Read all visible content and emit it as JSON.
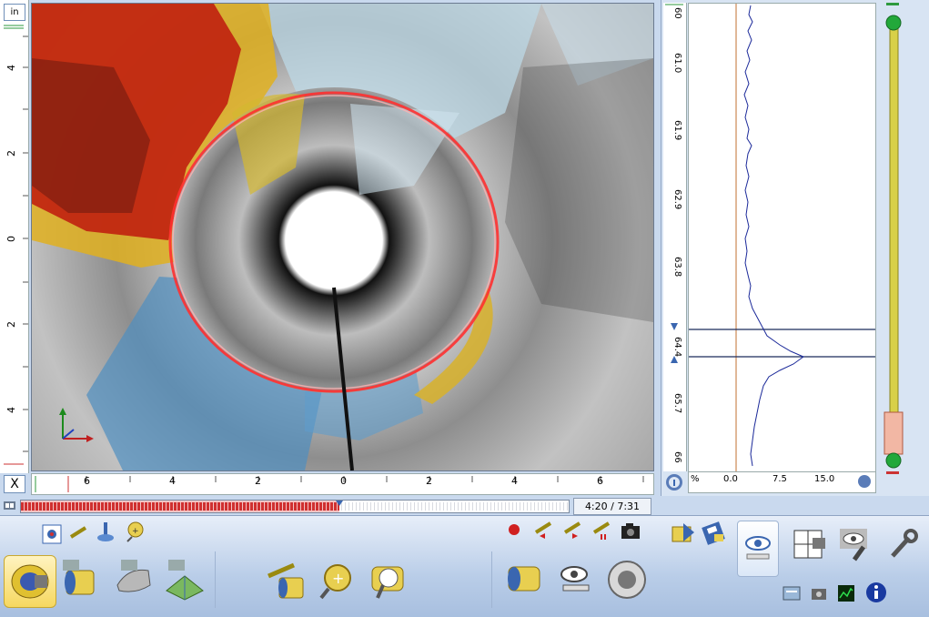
{
  "unit_label": "in",
  "close_label": "X",
  "time_readout": "4:20 / 7:31",
  "left_ruler_ticks": [
    "4",
    "2",
    "0",
    "2",
    "4"
  ],
  "bottom_ruler_ticks": [
    "6",
    "4",
    "2",
    "0",
    "2",
    "4",
    "6"
  ],
  "depth_ticks": [
    "60",
    "61.0",
    "61.9",
    "62.9",
    "63.8",
    "64.4",
    "65.7",
    "66"
  ],
  "plot_axis": {
    "unit": "%",
    "ticks": [
      "0.0",
      "7.5",
      "15.0"
    ]
  },
  "colors": {
    "accent": "#3a66b0",
    "track_marker": "#d03030",
    "slider_track": "#c8c040",
    "slider_knob": "#22a83a"
  },
  "toolbar": {
    "left_icons": [
      "pipe-view-icon",
      "pipe-cut-icon",
      "hand-pipe-icon",
      "flat-view-icon"
    ],
    "small_icons": [
      "screenshot-icon",
      "measure-line-icon",
      "probe-icon",
      "zoom-marker-icon"
    ],
    "center_icons": [
      "section-line-icon",
      "magnify-pipe-icon",
      "magnify-scan-icon"
    ],
    "record_icons": [
      "record-icon",
      "rewind-icon",
      "play-icon",
      "pause-icon",
      "camera-icon"
    ],
    "view_icons": [
      "pipe-color-icon",
      "eye-measure-icon",
      "sonar-icon"
    ],
    "right_icons": [
      "import-icon",
      "save-disk-icon",
      "eye-view-icon",
      "layout-grid-icon",
      "eye-settings-icon",
      "wrench-icon",
      "stack-icon",
      "camera-settings-icon",
      "oscilloscope-icon",
      "info-icon"
    ]
  }
}
